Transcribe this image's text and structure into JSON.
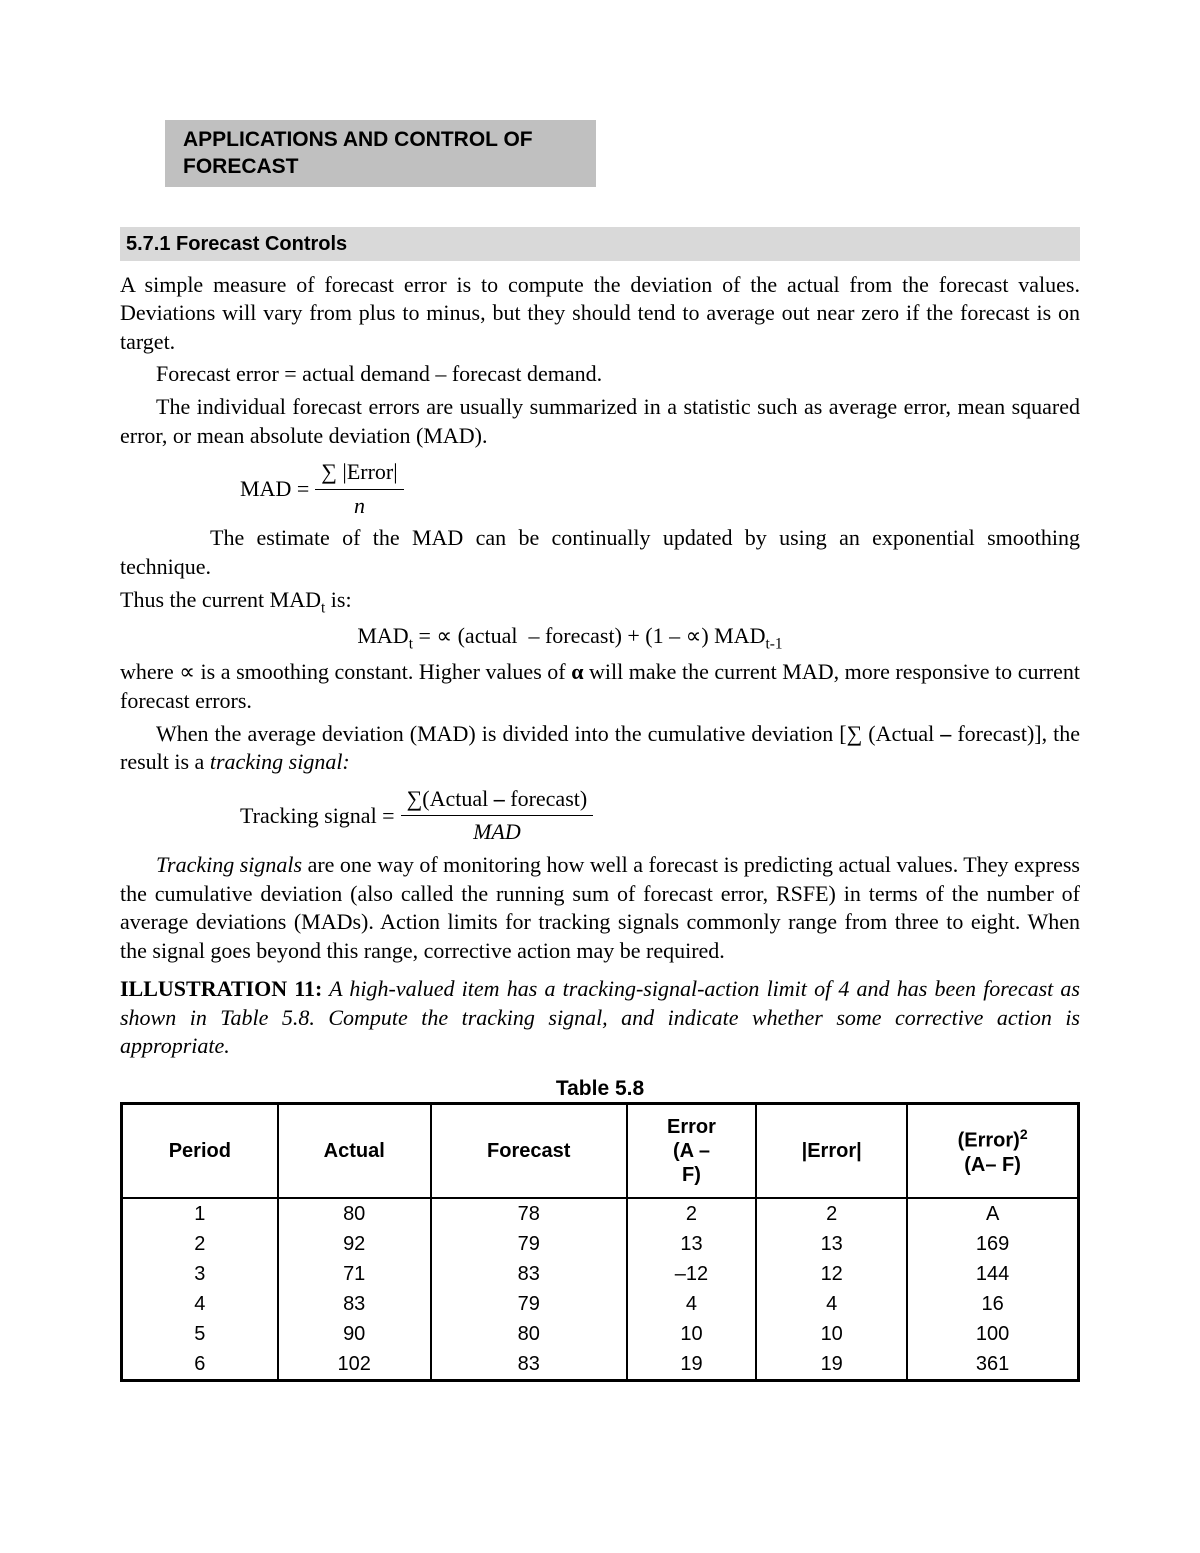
{
  "banner": "APPLICATIONS AND CONTROL OF FORECAST",
  "subsection": "5.7.1 Forecast Controls",
  "p1": "A simple measure of forecast error is to compute the deviation of the actual from the forecast values. Deviations will vary from plus to minus, but they should tend to average out near zero if the forecast is on target.",
  "p2": "Forecast error = actual demand – forecast demand.",
  "p3": "The individual forecast errors are usually summarized in a statistic such as average error, mean squared error, or mean absolute deviation (MAD).",
  "mad_eq": {
    "lhs": "MAD =",
    "num": "∑ |Error|",
    "den": "n"
  },
  "p4": "The estimate of the MAD can be continually updated by using an exponential smoothing technique.",
  "p5a": "Thus the current MAD",
  "p5b": " is:",
  "madt_eq": "MADt = ∝ (actual  – forecast) + (1 – ∝) MADt-1",
  "p6a": "where ∝ is a smoothing constant. Higher values of ",
  "p6alpha": "α",
  "p6b": " will make the current MAD, more responsive to current forecast errors.",
  "p7a": "When the average deviation (MAD) is divided into the cumulative deviation [∑ (Actual ",
  "p7dash": "–",
  "p7b": " forecast)], the result is a ",
  "p7ts": "tracking signal:",
  "ts_eq": {
    "lhs": "Tracking signal =",
    "num_a": "∑(Actual ",
    "num_dash": "–",
    "num_b": "  forecast)",
    "den": "MAD"
  },
  "p8a": "Tracking signals",
  "p8b": " are one way of monitoring how well a forecast is predicting actual values. They express the cumulative deviation (also called the running sum of forecast error, RSFE) in terms of the number of average deviations (MADs). Action limits for tracking signals commonly range from three to eight. When the signal goes beyond this range, corrective action may be required.",
  "ill_label": "ILLUSTRATION 11:",
  "ill_text": " A high-valued item has a tracking-signal-action limit of 4 and has been forecast as shown in Table 5.8. Compute the tracking signal, and indicate whether some corrective action is appropriate.",
  "table": {
    "title": "Table 5.8",
    "headers": {
      "period": "Period",
      "actual": "Actual",
      "forecast": "Forecast",
      "error": "Error\n(A – F)",
      "abserror": "|Error|",
      "sqerror": "(Error)²\n(A– F)"
    },
    "rows": [
      {
        "period": "1",
        "actual": "80",
        "forecast": "78",
        "error": "2",
        "abserror": "2",
        "sqerror": "A"
      },
      {
        "period": "2",
        "actual": "92",
        "forecast": "79",
        "error": "13",
        "abserror": "13",
        "sqerror": "169"
      },
      {
        "period": "3",
        "actual": "71",
        "forecast": "83",
        "error": "–12",
        "abserror": "12",
        "sqerror": "144"
      },
      {
        "period": "4",
        "actual": "83",
        "forecast": "79",
        "error": "4",
        "abserror": "4",
        "sqerror": "16"
      },
      {
        "period": "5",
        "actual": "90",
        "forecast": "80",
        "error": "10",
        "abserror": "10",
        "sqerror": "100"
      },
      {
        "period": "6",
        "actual": "102",
        "forecast": "83",
        "error": "19",
        "abserror": "19",
        "sqerror": "361"
      }
    ]
  },
  "chart_data": {
    "type": "table",
    "title": "Table 5.8",
    "columns": [
      "Period",
      "Actual",
      "Forecast",
      "Error (A – F)",
      "|Error|",
      "(Error)² (A– F)"
    ],
    "rows": [
      [
        1,
        80,
        78,
        2,
        2,
        "A"
      ],
      [
        2,
        92,
        79,
        13,
        13,
        169
      ],
      [
        3,
        71,
        83,
        -12,
        12,
        144
      ],
      [
        4,
        83,
        79,
        4,
        4,
        16
      ],
      [
        5,
        90,
        80,
        10,
        10,
        100
      ],
      [
        6,
        102,
        83,
        19,
        19,
        361
      ]
    ]
  }
}
